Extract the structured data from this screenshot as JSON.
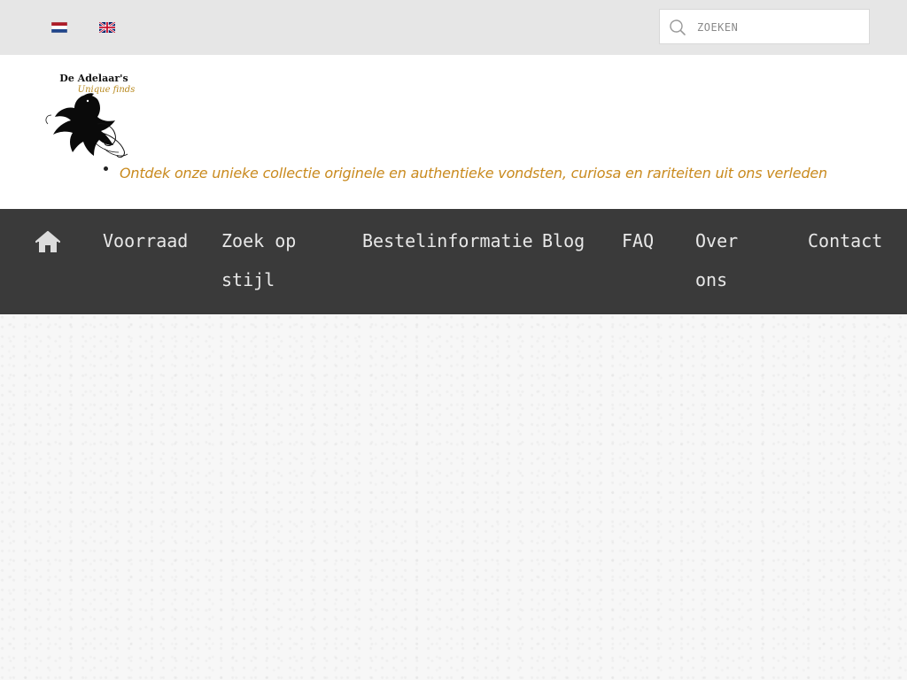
{
  "topbar": {
    "languages": [
      {
        "code": "nl",
        "icon": "netherlands-flag-icon"
      },
      {
        "code": "en",
        "icon": "uk-flag-icon"
      }
    ],
    "search": {
      "placeholder": "ZOEKEN",
      "value": "",
      "icon": "search-icon"
    }
  },
  "header": {
    "logo_text_line1": "De Adelaar's",
    "logo_text_line2": "Unique finds",
    "tagline": "Ontdek onze unieke collectie originele en authentieke vondsten, curiosa en rariteiten uit ons verleden"
  },
  "nav": {
    "home_icon": "home-icon",
    "items": [
      {
        "line1": "Voorraad",
        "line2": ""
      },
      {
        "line1": "Zoek op",
        "line2": "stijl"
      },
      {
        "line1": "Bestelinformatie",
        "line2": ""
      },
      {
        "line1": "Blog",
        "line2": ""
      },
      {
        "line1": "FAQ",
        "line2": ""
      },
      {
        "line1": "Over",
        "line2": "ons"
      },
      {
        "line1": "Contact",
        "line2": ""
      }
    ]
  },
  "colors": {
    "topbar_bg": "#e6e6e6",
    "nav_bg": "#3a3a3a",
    "nav_text": "#e8e8e8",
    "tagline": "#c98a1e",
    "content_bg": "#f7f7f7"
  }
}
